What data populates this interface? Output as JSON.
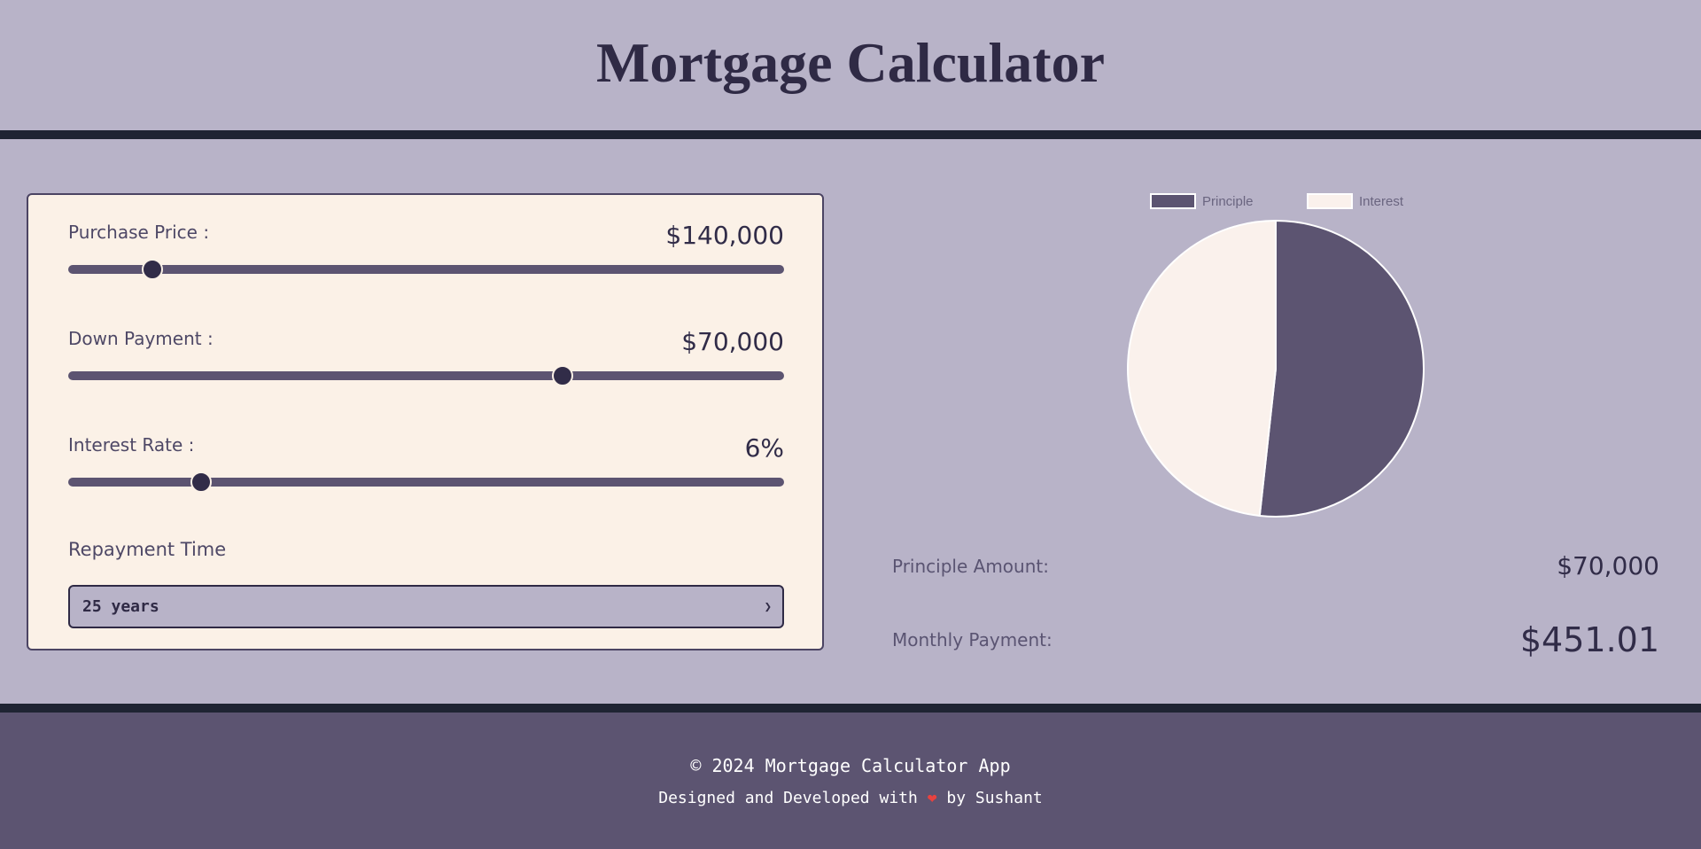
{
  "header": {
    "title": "Mortgage Calculator"
  },
  "form": {
    "purchase_price": {
      "label": "Purchase Price :",
      "value": "$140,000",
      "slider_fraction": 0.118
    },
    "down_payment": {
      "label": "Down Payment :",
      "value": "$70,000",
      "slider_fraction": 0.69
    },
    "interest_rate": {
      "label": "Interest Rate :",
      "value": "6%",
      "slider_fraction": 0.186
    },
    "repayment": {
      "label": "Repayment Time",
      "selected": "25 years"
    }
  },
  "chart_data": {
    "type": "pie",
    "categories": [
      "Principle",
      "Interest"
    ],
    "values": [
      70000,
      65303
    ],
    "colors": [
      "#5c5471",
      "#faf1ec"
    ],
    "legend_position": "top"
  },
  "summary": {
    "principle_label": "Principle Amount:",
    "principle_value": "$70,000",
    "monthly_label": "Monthly Payment:",
    "monthly_value": "$451.01"
  },
  "footer": {
    "copyright": "© 2024 Mortgage Calculator App",
    "credit_prefix": "Designed and Developed with",
    "heart": "❤",
    "credit_suffix": "by Sushant"
  },
  "colors": {
    "accent": "#5c5471",
    "dark": "#312c48",
    "card": "#fbf1e7",
    "background": "#b8b3c8",
    "footer": "#5c5471"
  }
}
